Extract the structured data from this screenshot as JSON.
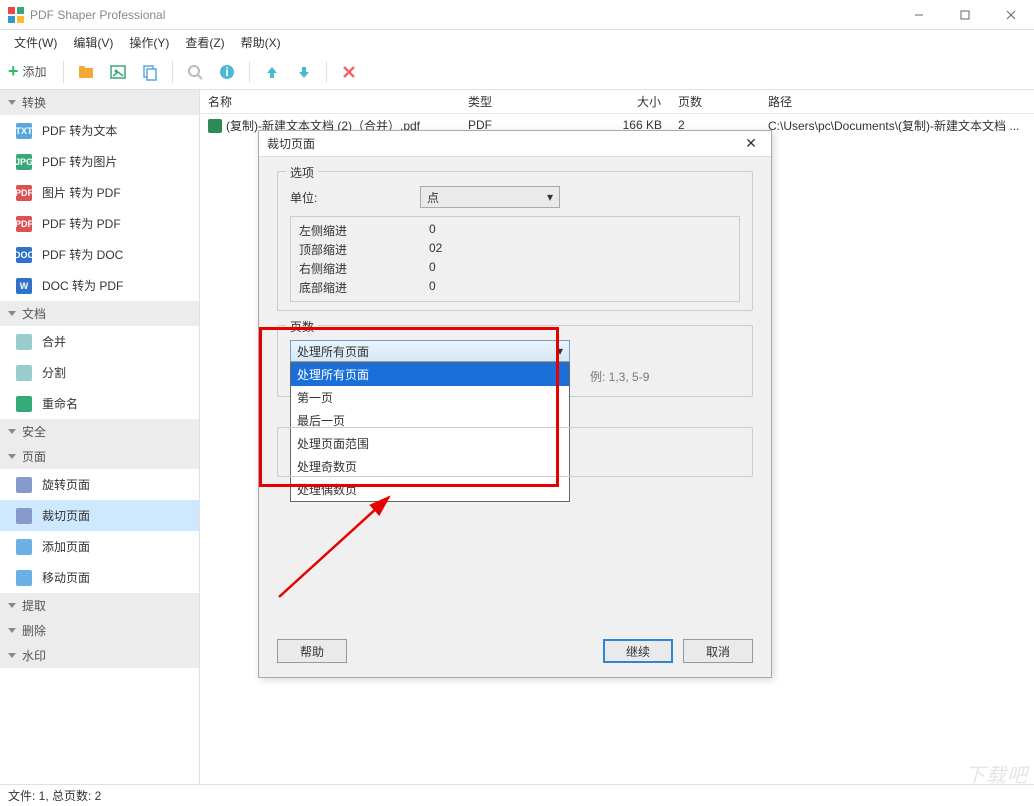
{
  "window": {
    "title": "PDF Shaper Professional"
  },
  "menubar": [
    "文件(W)",
    "编辑(V)",
    "操作(Y)",
    "查看(Z)",
    "帮助(X)"
  ],
  "toolbar": {
    "add_label": "添加"
  },
  "sidebar": {
    "sections": [
      {
        "title": "转换",
        "items": [
          {
            "label": "PDF 转为文本",
            "icon": "TXT",
            "color": "#5aa7e0"
          },
          {
            "label": "PDF 转为图片",
            "icon": "JPG",
            "color": "#3aa77a"
          },
          {
            "label": "图片 转为 PDF",
            "icon": "PDF",
            "color": "#d85454"
          },
          {
            "label": "PDF 转为 PDF",
            "icon": "PDF",
            "color": "#d85454"
          },
          {
            "label": "PDF 转为 DOC",
            "icon": "DOC",
            "color": "#2f72c9"
          },
          {
            "label": "DOC 转为 PDF",
            "icon": "W",
            "color": "#2f72c9"
          }
        ]
      },
      {
        "title": "文档",
        "items": [
          {
            "label": "合并",
            "icon": "",
            "color": "#9cc"
          },
          {
            "label": "分割",
            "icon": "",
            "color": "#9cc"
          },
          {
            "label": "重命名",
            "icon": "",
            "color": "#3a7"
          }
        ]
      },
      {
        "title": "安全",
        "items": []
      },
      {
        "title": "页面",
        "items": [
          {
            "label": "旋转页面",
            "icon": "",
            "color": "#89c"
          },
          {
            "label": "裁切页面",
            "icon": "",
            "color": "#89c",
            "selected": true
          },
          {
            "label": "添加页面",
            "icon": "",
            "color": "#6bb1e8"
          },
          {
            "label": "移动页面",
            "icon": "",
            "color": "#6bb1e8"
          }
        ]
      },
      {
        "title": "提取",
        "items": []
      },
      {
        "title": "删除",
        "items": []
      },
      {
        "title": "水印",
        "items": []
      }
    ]
  },
  "list": {
    "headers": {
      "name": "名称",
      "type": "类型",
      "size": "大小",
      "pages": "页数",
      "path": "路径"
    },
    "rows": [
      {
        "name": "(复制)-新建文本文档 (2)（合并）.pdf",
        "type": "PDF",
        "size": "166 KB",
        "pages": "2",
        "path": "C:\\Users\\pc\\Documents\\(复制)-新建文本文档 ..."
      }
    ]
  },
  "statusbar": "文件: 1, 总页数: 2",
  "dialog": {
    "title": "裁切页面",
    "options_legend": "选项",
    "unit_label": "单位:",
    "unit_value": "点",
    "margins": [
      {
        "label": "左侧缩进",
        "value": "0"
      },
      {
        "label": "顶部缩进",
        "value": "02"
      },
      {
        "label": "右侧缩进",
        "value": "0"
      },
      {
        "label": "底部缩进",
        "value": "0"
      }
    ],
    "pages_legend": "页数",
    "pages_note": "例: 1,3, 5-9",
    "pages_combo_value": "处理所有页面",
    "pages_options": [
      "处理所有页面",
      "第一页",
      "最后一页",
      "处理页面范围",
      "处理奇数页",
      "处理偶数页"
    ],
    "help_btn": "帮助",
    "continue_btn": "继续",
    "cancel_btn": "取消"
  },
  "watermark": "下载吧"
}
